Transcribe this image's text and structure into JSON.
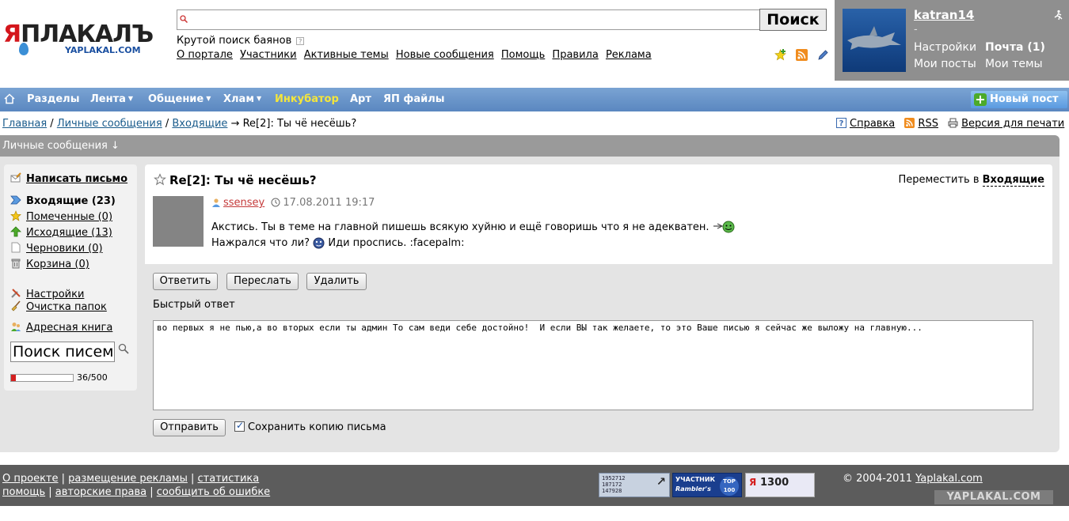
{
  "logo": {
    "main_red": "Я",
    "main_rest": "ПЛАКАЛЪ",
    "sub": "YAPLAKAL.COM"
  },
  "search": {
    "value": "",
    "button": "Поиск",
    "hint": "Крутой поиск баянов",
    "hint_icon": "?"
  },
  "top_nav": [
    "О портале",
    "Участники",
    "Активные темы",
    "Новые сообщения",
    "Помощь",
    "Правила",
    "Реклама"
  ],
  "user": {
    "name": "katran14",
    "dash": "-",
    "settings": "Настройки",
    "mail": "Почта (1)",
    "my_posts": "Мои посты",
    "my_topics": "Мои темы"
  },
  "menu": {
    "items": [
      {
        "label": "Разделы"
      },
      {
        "label": "Лента",
        "arrow": "▼"
      },
      {
        "label": "Общение",
        "arrow": "▼"
      },
      {
        "label": "Хлам",
        "arrow": "▼"
      },
      {
        "label": "Инкубатор"
      },
      {
        "label": "Арт"
      },
      {
        "label": "ЯП файлы"
      }
    ],
    "new_post": "Новый пост",
    "new_post_icon": "+"
  },
  "breadcrumb": {
    "home": "Главная",
    "sep1": " / ",
    "pm": "Личные сообщения",
    "sep2": " / ",
    "inbox": "Входящие",
    "arrow": " → ",
    "current": "Re[2]: Ты чё несёшь?"
  },
  "tools": {
    "help": "Справка",
    "rss": "RSS",
    "print": "Версия для печати"
  },
  "section_title": "Личные сообщения ↓",
  "sidebar": {
    "compose": "Написать письмо",
    "inbox": "Входящие (23)",
    "marked": "Помеченные (0)",
    "outbox": "Исходящие (13)",
    "drafts": "Черновики (0)",
    "trash": "Корзина (0)",
    "settings": "Настройки",
    "cleanup": "Очистка папок",
    "addressbook": "Адресная книга",
    "search_value": "Поиск писем",
    "quota_text": "36/500",
    "quota_fraction": 0.072
  },
  "message": {
    "title": "Re[2]: Ты чё несёшь?",
    "move_label": "Переместить в ",
    "move_target": "Входящие",
    "author": "ssensey",
    "date": "17.08.2011 19:17",
    "line1": "Акстись. Ты в теме на главной пишешь всякую хуйню и ещё говоришь что я не адекватен.",
    "line2a": "Нажрался что ли?",
    "line2b": "Иди проспись. :facepalm:"
  },
  "actions": {
    "reply": "Ответить",
    "forward": "Переслать",
    "delete": "Удалить"
  },
  "quick_reply": {
    "label": "Быстрый ответ",
    "text": "во первых я не пью,а во вторых если ты админ То сам веди себе достойно!  И если ВЫ так желаете, то это Ваше писью я сейчас же выложу на главную...",
    "send": "Отправить",
    "save_copy": "Сохранить копию письма"
  },
  "footer": {
    "about": "О проекте",
    "ads": "размещение рекламы",
    "stats": "статистика",
    "help": "помощь",
    "copyright_link": "авторские права",
    "report": "сообщить об ошибке",
    "sep": " | ",
    "copyright_prefix": "© 2004-2011 ",
    "site": "Yaplakal.com",
    "logo": "YAPLAKAL.COM",
    "counter1": [
      "1952712",
      "187172",
      "147928"
    ],
    "counter1_arrow": "↗",
    "counter2": {
      "line1": "УЧАСТНИК",
      "line2": "Rambler's",
      "top": "TOP",
      "top_n": "100"
    },
    "counter3": {
      "y": "Я",
      "n": "1300"
    }
  },
  "colors": {
    "menu_blue": "#5a87c0",
    "incubator": "#f5e63a",
    "author_red": "#c43a3a",
    "panel_grey": "#9a9a9a"
  }
}
